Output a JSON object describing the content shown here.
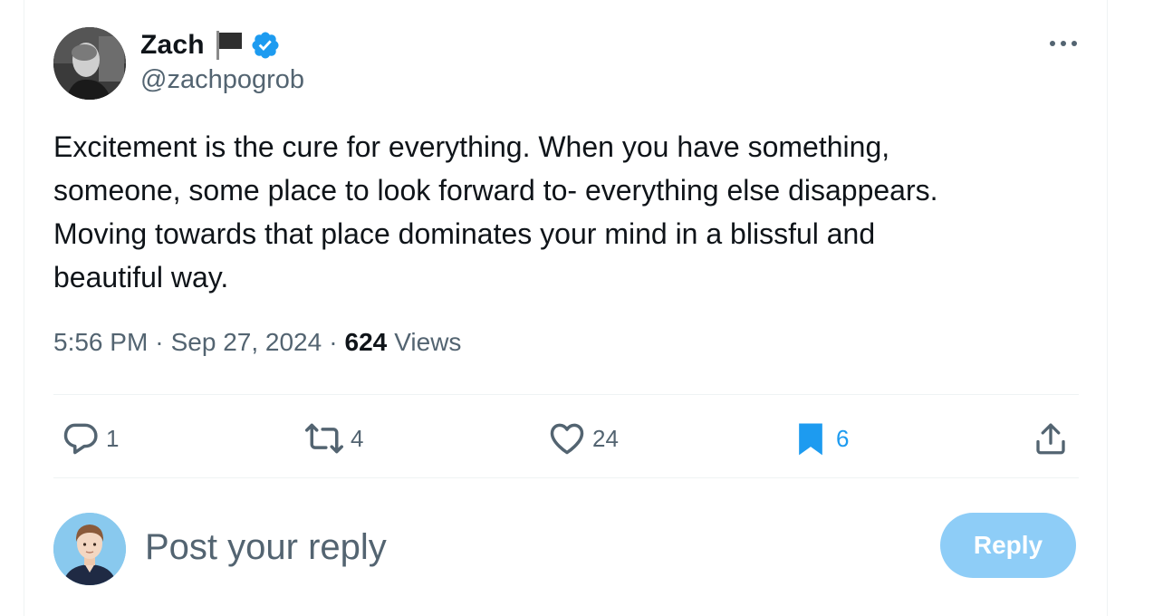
{
  "author": {
    "name": "Zach",
    "handle": "@zachpogrob",
    "badge_icons": [
      "black-flag-icon",
      "verified-badge-icon"
    ]
  },
  "tweet": {
    "text_lines": [
      "Excitement is the cure for everything. When you have something,",
      "someone, some place to look forward to- everything else disappears.",
      "Moving towards that place dominates your mind in a blissful and",
      "beautiful way."
    ],
    "time": "5:56 PM",
    "date": "Sep 27, 2024",
    "views_count": "624",
    "views_label": "Views",
    "separator": "·"
  },
  "actions": {
    "replies": "1",
    "reposts": "4",
    "likes": "24",
    "bookmarks": "6"
  },
  "reply_box": {
    "placeholder": "Post your reply",
    "button_label": "Reply"
  },
  "colors": {
    "accent": "#1d9bf0",
    "secondary_text": "#536471",
    "reply_button_disabled": "#8ecdf7"
  }
}
